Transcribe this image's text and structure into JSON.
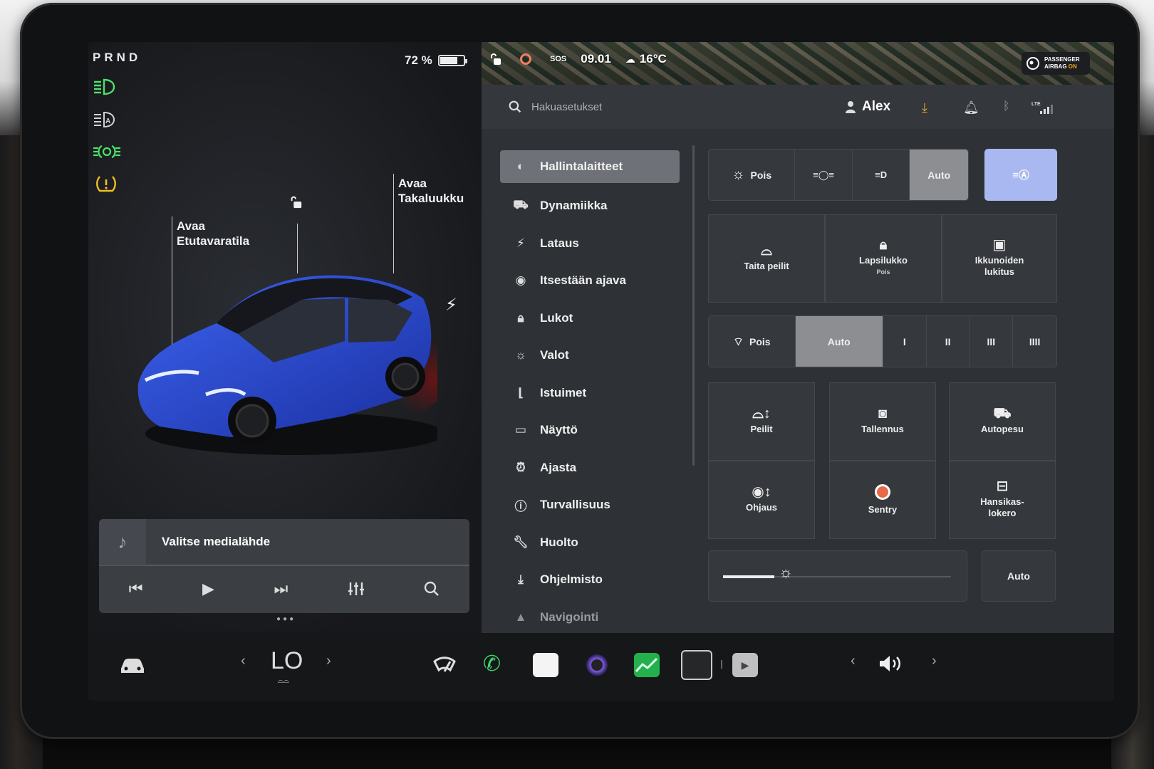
{
  "left_panel": {
    "gear": "PRND",
    "battery_percent": "72 %",
    "battery_level": 0.72,
    "telltales": [
      "high-beam-icon",
      "auto-high-beam-icon",
      "parking-lights-icon",
      "tire-pressure-warning-icon"
    ],
    "label_frunk": "Avaa\nEtutavaratila",
    "label_trunk": "Avaa\nTakaluukku",
    "car_color": "#2a4fd8"
  },
  "media": {
    "title": "Valitse medialähde",
    "controls": [
      "previous-icon",
      "play-icon",
      "next-icon",
      "equalizer-icon",
      "search-icon"
    ]
  },
  "status_bar": {
    "sos": "SOS",
    "time": "09.01",
    "temperature": "16°C",
    "airbag_line1": "PASSENGER",
    "airbag_line2": "AIRBAG",
    "airbag_state": "ON"
  },
  "search": {
    "placeholder": "Hakuasetukset"
  },
  "user": {
    "name": "Alex"
  },
  "menu": [
    {
      "label": "Hallintalaitteet",
      "icon": "toggle-icon",
      "active": true
    },
    {
      "label": "Dynamiikka",
      "icon": "car-icon"
    },
    {
      "label": "Lataus",
      "icon": "bolt-icon"
    },
    {
      "label": "Itsestään ajava",
      "icon": "steering-wheel-icon"
    },
    {
      "label": "Lukot",
      "icon": "lock-icon"
    },
    {
      "label": "Valot",
      "icon": "light-icon"
    },
    {
      "label": "Istuimet",
      "icon": "seat-icon"
    },
    {
      "label": "Näyttö",
      "icon": "display-icon"
    },
    {
      "label": "Ajasta",
      "icon": "alarm-clock-icon"
    },
    {
      "label": "Turvallisuus",
      "icon": "alert-icon"
    },
    {
      "label": "Huolto",
      "icon": "wrench-icon"
    },
    {
      "label": "Ohjelmisto",
      "icon": "download-icon"
    },
    {
      "label": "Navigointi",
      "icon": "navigation-icon"
    }
  ],
  "controls": {
    "lights": {
      "off": "Pois",
      "auto": "Auto",
      "selected": "Auto"
    },
    "mirrors_fold": "Taita peilit",
    "child_lock": "Lapsilukko",
    "child_lock_state": "Pois",
    "window_lock": "Ikkunoiden\nlukitus",
    "wipers": {
      "off": "Pois",
      "auto": "Auto",
      "speeds": [
        "I",
        "II",
        "III",
        "IIII"
      ],
      "selected": "Auto"
    },
    "mirrors": "Peilit",
    "dashcam": "Tallennus",
    "car_wash": "Autopesu",
    "steering": "Ohjaus",
    "sentry": "Sentry",
    "glovebox": "Hansikas-\nlokero",
    "brightness_auto": "Auto",
    "brightness_level": 0.1
  },
  "dock": {
    "climate_value": "LO",
    "apps": [
      "car-icon",
      "wiper-icon",
      "phone-icon",
      "calendar-icon",
      "camera-icon",
      "energy-icon",
      "app-launcher-icon",
      "video-icon"
    ],
    "volume_icon": "volume-icon"
  }
}
